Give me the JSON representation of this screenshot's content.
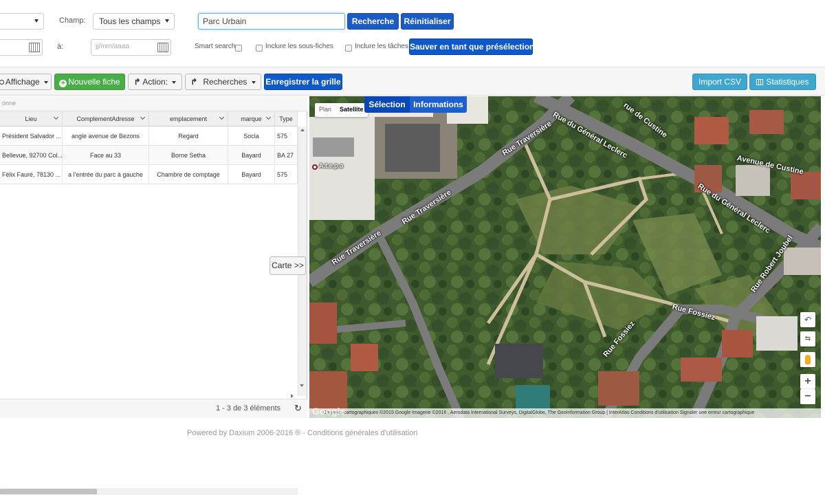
{
  "filters": {
    "champ_label": "Champ:",
    "champ_value": "Tous les champs",
    "search_value": "Parc Urbain",
    "search_button": "Recherche",
    "reset_button": "Réinitialiser",
    "date_to_label": "à:",
    "date_placeholder": "jj/mm/aaaa",
    "smart_search_label": "Smart search",
    "sub_sheets_label": "Inclure les sous-fiches",
    "tasks_label": "Inclure les tâches",
    "save_preset_button": "Sauver en tant que présélection"
  },
  "toolbar": {
    "display_button": "Affichage",
    "new_sheet_button": "Nouvelle fiche",
    "action_button": "Action:",
    "searches_button": "Recherches",
    "save_grid_button": "Enregistrer la grille",
    "import_csv_button": "Import CSV",
    "stats_button": "Statistiques"
  },
  "grid": {
    "group_hint": "onne",
    "columns": [
      "Lieu",
      "ComplementAdresse",
      "emplacement",
      "marque",
      "Type"
    ],
    "rows": [
      [
        "Président Salvador ...",
        "angle avenue de Bezons",
        "Regard",
        "Socla",
        "575"
      ],
      [
        "Bellevue, 92700 Col...",
        "Face au 33",
        "Borne Setha",
        "Bayard",
        "BA 27"
      ],
      [
        "Félix Fauré, 78130 ...",
        "a l'entrée du parc à gauche",
        "Chambre de comptage",
        "Bayard",
        "575"
      ]
    ],
    "pager": "1 - 3 de 3 éléments",
    "map_toggle": "Carte >>"
  },
  "map": {
    "plan_label": "Plan",
    "satellite_label": "Satellite",
    "selection_tab": "Sélection",
    "informations_tab": "Informations",
    "place_label": "A.t.e.p.a",
    "streets": [
      "Rue Traversière",
      "Rue Traversière",
      "Rue Traversière",
      "Rue du Général Leclerc",
      "Rue du Général Leclerc",
      "Avenue de Custine",
      "rue de Custine",
      "Rue Robert Joubel",
      "Rue Fossiez",
      "Rue Fossiez"
    ],
    "copyright": "Données cartographiques ©2015 Google Imagerie ©2016 , Aerodata International Surveys, DigitalGlobe, The GeoInformation Group | InterAtlas  Conditions d'utilisation   Signaler une erreur cartographique",
    "google_logo": "Google"
  },
  "footer": {
    "text": "Powered by Daxium 2006-2016 ® - Conditions générales d'utilisation"
  }
}
